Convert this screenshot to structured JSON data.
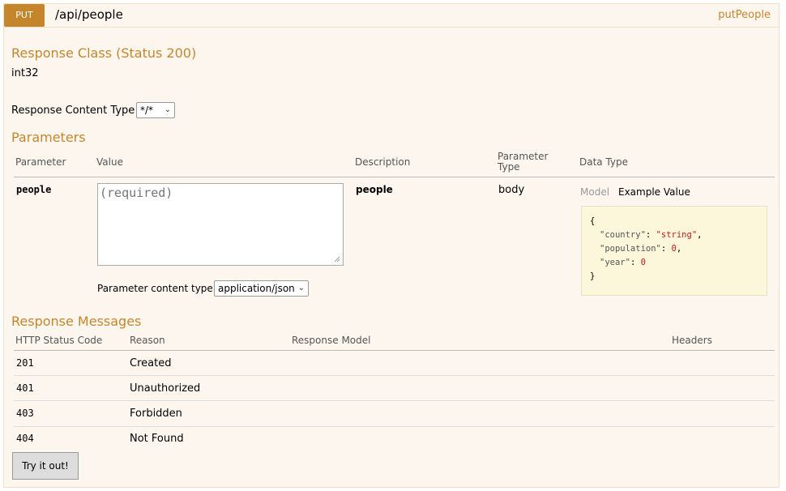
{
  "header": {
    "method": "PUT",
    "path": "/api/people",
    "nickname": "putPeople"
  },
  "response_class": {
    "title": "Response Class (Status 200)",
    "type": "int32",
    "content_type_label": "Response Content Type",
    "content_type_value": "*/*"
  },
  "parameters": {
    "title": "Parameters",
    "columns": [
      "Parameter",
      "Value",
      "Description",
      "Parameter Type",
      "Data Type"
    ],
    "column_type_line1": "Parameter",
    "column_type_line2": "Type",
    "row": {
      "name": "people",
      "placeholder": "(required)",
      "description": "people",
      "param_type": "body",
      "tab_model": "Model",
      "tab_example": "Example Value",
      "content_type_label": "Parameter content type:",
      "content_type_value": "application/json"
    },
    "example": {
      "open": "{",
      "country_key": "\"country\"",
      "country_val": "\"string\"",
      "population_key": "\"population\"",
      "population_val": "0",
      "year_key": "\"year\"",
      "year_val": "0",
      "close": "}"
    }
  },
  "response_messages": {
    "title": "Response Messages",
    "columns": [
      "HTTP Status Code",
      "Reason",
      "Response Model",
      "Headers"
    ],
    "rows": [
      {
        "code": "201",
        "reason": "Created"
      },
      {
        "code": "401",
        "reason": "Unauthorized"
      },
      {
        "code": "403",
        "reason": "Forbidden"
      },
      {
        "code": "404",
        "reason": "Not Found"
      }
    ]
  },
  "try_button": "Try it out!",
  "colors": {
    "accent": "#c5862b",
    "panel_bg": "#fcf6ef",
    "snippet_bg": "#fcf6db"
  }
}
